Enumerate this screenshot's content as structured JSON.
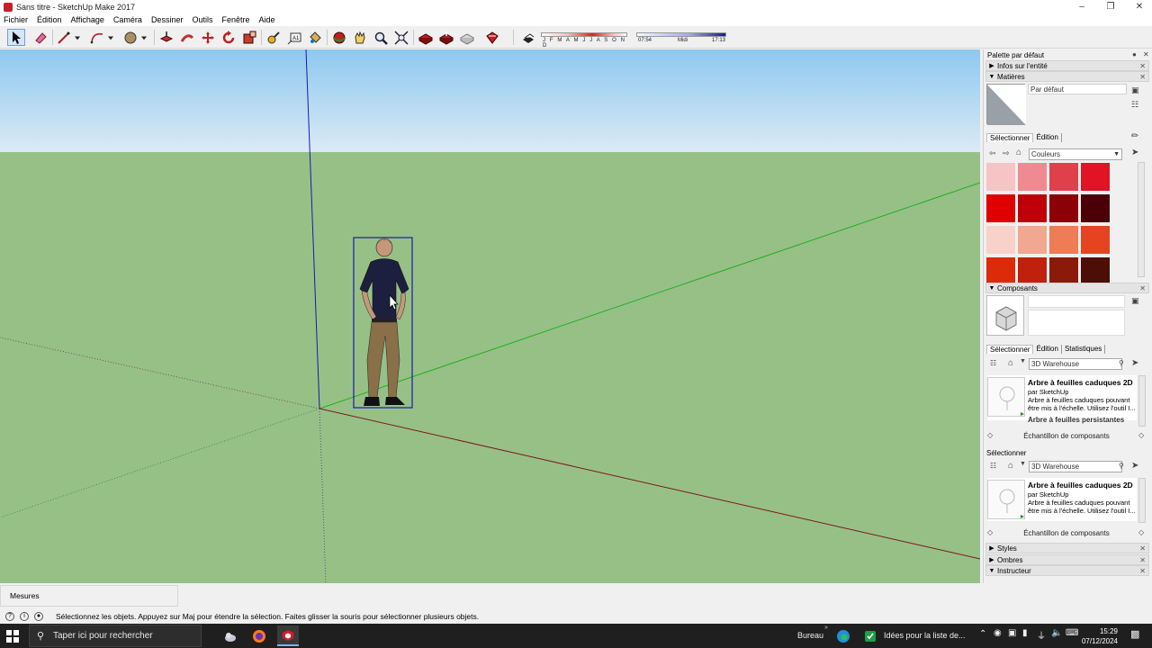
{
  "window": {
    "title": "Sans titre - SketchUp Make 2017"
  },
  "menu": [
    "Fichier",
    "Édition",
    "Affichage",
    "Caméra",
    "Dessiner",
    "Outils",
    "Fenêtre",
    "Aide"
  ],
  "shadows": {
    "months": "J F M A M J J A S O N D",
    "time_start": "07:54",
    "time_mid": "Midi",
    "time_end": "17:13"
  },
  "tray": {
    "title": "Palette par défaut",
    "panels": {
      "entity_info": "Infos sur l'entité",
      "materials": "Matières",
      "components": "Composants",
      "styles": "Styles",
      "shadows": "Ombres",
      "instructor": "Instructeur"
    },
    "materials": {
      "name": "Par défaut",
      "tabs": [
        "Sélectionner",
        "Édition"
      ],
      "library": "Couleurs",
      "swatches": [
        "#f6c4c4",
        "#f08a92",
        "#e0404c",
        "#e01424",
        "#e00000",
        "#c00008",
        "#8c0008",
        "#4a0006",
        "#f8d2c8",
        "#f2a890",
        "#ee7c54",
        "#e64420",
        "#dc2a0a",
        "#c0200c",
        "#8c1a0a",
        "#4c0e06"
      ]
    },
    "components": {
      "tabs": [
        "Sélectionner",
        "Édition",
        "Statistiques"
      ],
      "search": "3D Warehouse",
      "item": {
        "name": "Arbre à feuilles caduques 2D",
        "by": "par SketchUp",
        "desc": "Arbre à feuilles caduques pouvant être mis à l'échelle. Utilisez l'outil I..."
      },
      "next_item": "Arbre à feuilles persistantes",
      "sample": "Échantillon de composants",
      "secondary_title": "Sélectionner"
    }
  },
  "measures_label": "Mesures",
  "status_message": "Sélectionnez les objets. Appuyez sur Maj pour étendre la sélection. Faites glisser la souris pour sélectionner plusieurs objets.",
  "taskbar": {
    "search_placeholder": "Taper ici pour rechercher",
    "desktop": "Bureau",
    "notification": "Idées pour la liste de...",
    "time": "15:29",
    "date": "07/12/2024"
  },
  "colors": {
    "sky_top": "#8ec8ef",
    "sky_bottom": "#dbeaf5",
    "ground": "#97c087",
    "selection": "#1a1aaa",
    "green_axis": "#1db11d",
    "red_axis": "#7a1a1a"
  }
}
